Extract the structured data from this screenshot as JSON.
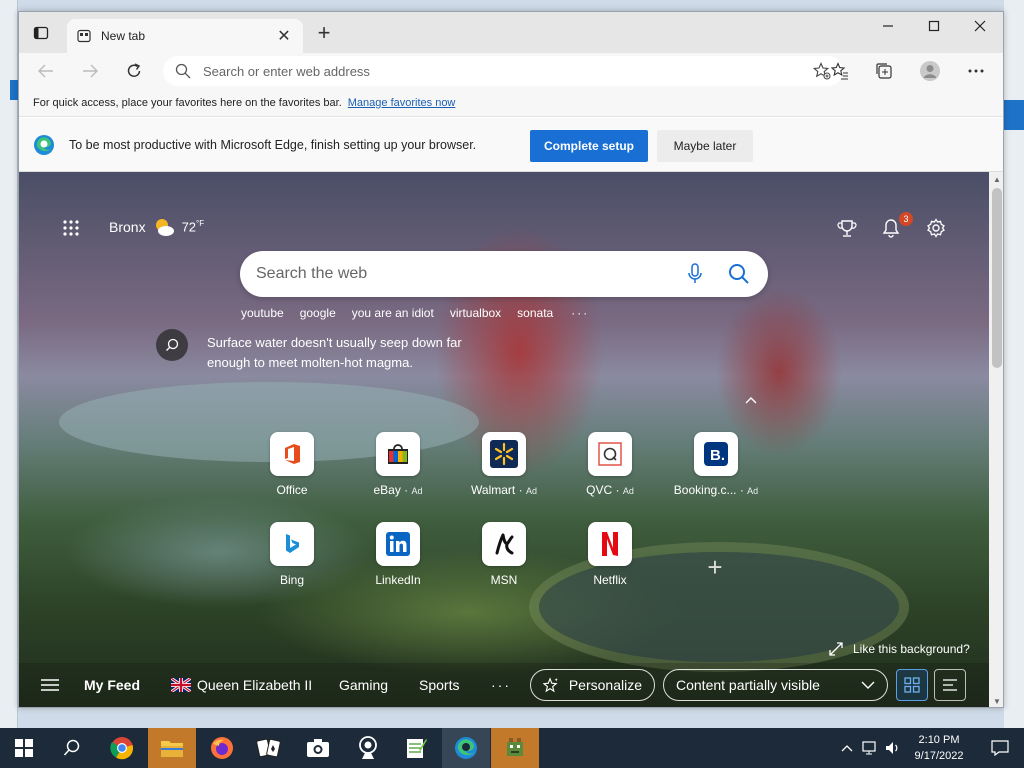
{
  "browser": {
    "tab_title": "New tab",
    "address_placeholder": "Search or enter web address",
    "favorites_bar_text": "For quick access, place your favorites here on the favorites bar.",
    "favorites_link": "Manage favorites now"
  },
  "infobar": {
    "message": "To be most productive with Microsoft Edge, finish setting up your browser.",
    "primary_button": "Complete setup",
    "secondary_button": "Maybe later"
  },
  "newtab": {
    "location": "Bronx",
    "temperature": "72",
    "temperature_unit": "°F",
    "notification_count": "3",
    "search_placeholder": "Search the web",
    "suggestions": [
      "youtube",
      "google",
      "you are an idiot",
      "virtualbox",
      "sonata"
    ],
    "fact": "Surface water doesn't usually seep down far enough to meet molten-hot magma.",
    "tiles_row1": [
      {
        "label": "Office",
        "ad": ""
      },
      {
        "label": "eBay",
        "ad": "Ad"
      },
      {
        "label": "Walmart",
        "ad": "Ad"
      },
      {
        "label": "QVC",
        "ad": "Ad"
      },
      {
        "label": "Booking.c...",
        "ad": "Ad"
      }
    ],
    "tiles_row2": [
      {
        "label": "Bing"
      },
      {
        "label": "LinkedIn"
      },
      {
        "label": "MSN"
      },
      {
        "label": "Netflix"
      }
    ],
    "like_background": "Like this background?",
    "feed": {
      "my_feed": "My Feed",
      "topic_1": "Queen Elizabeth II",
      "topic_2": "Gaming",
      "topic_3": "Sports",
      "personalize": "Personalize",
      "content_visibility": "Content partially visible"
    }
  },
  "taskbar": {
    "time": "2:10 PM",
    "date": "9/17/2022"
  },
  "colors": {
    "accent": "#1a6fd4",
    "link": "#1a5fb4",
    "badge": "#d24726",
    "taskbar": "#1c2a3a"
  }
}
